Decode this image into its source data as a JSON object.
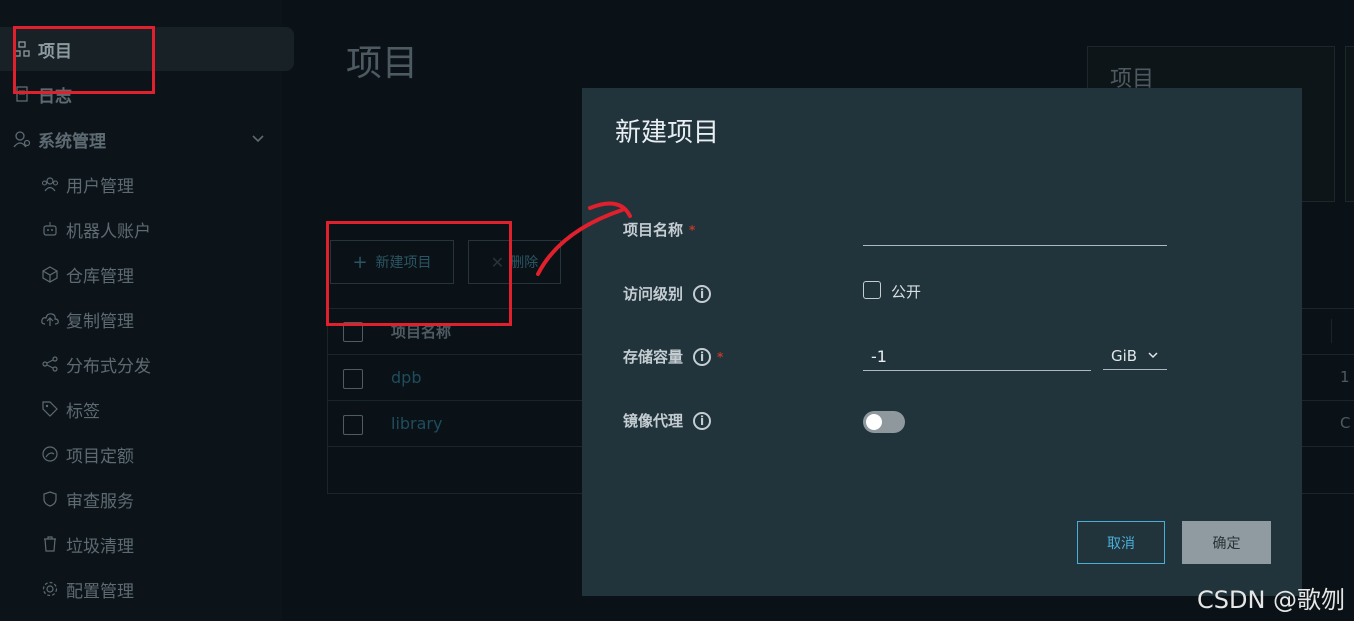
{
  "sidebar": {
    "items": [
      {
        "label": "项目",
        "icon": "projects-icon",
        "active": true
      },
      {
        "label": "日志",
        "icon": "logs-icon"
      },
      {
        "label": "系统管理",
        "icon": "admin-icon"
      }
    ],
    "sub_items": [
      {
        "label": "用户管理",
        "icon": "users-icon"
      },
      {
        "label": "机器人账户",
        "icon": "robot-icon"
      },
      {
        "label": "仓库管理",
        "icon": "cube-icon"
      },
      {
        "label": "复制管理",
        "icon": "cloud-upload-icon"
      },
      {
        "label": "分布式分发",
        "icon": "share-icon"
      },
      {
        "label": "标签",
        "icon": "tag-icon"
      },
      {
        "label": "项目定额",
        "icon": "quota-icon"
      },
      {
        "label": "审查服务",
        "icon": "shield-icon"
      },
      {
        "label": "垃圾清理",
        "icon": "trash-icon"
      },
      {
        "label": "配置管理",
        "icon": "gear-icon"
      }
    ]
  },
  "main": {
    "title": "项目",
    "summary_card_title": "项目",
    "toolbar": {
      "new_label": "新建项目",
      "delete_label": "删除"
    },
    "table": {
      "header": "项目名称",
      "rows": [
        {
          "name": "dpb",
          "right": "1"
        },
        {
          "name": "library",
          "right": "C"
        }
      ]
    }
  },
  "modal": {
    "title": "新建项目",
    "fields": {
      "name_label": "项目名称",
      "access_label": "访问级别",
      "public_label": "公开",
      "storage_label": "存储容量",
      "storage_value": "-1",
      "storage_unit": "GiB",
      "proxy_label": "镜像代理"
    },
    "cancel_label": "取消",
    "ok_label": "确定"
  },
  "watermark": "CSDN @歌刎",
  "colors": {
    "annotation_red": "#e0202d",
    "accent": "#49afd9",
    "modal_bg": "#21333b"
  }
}
